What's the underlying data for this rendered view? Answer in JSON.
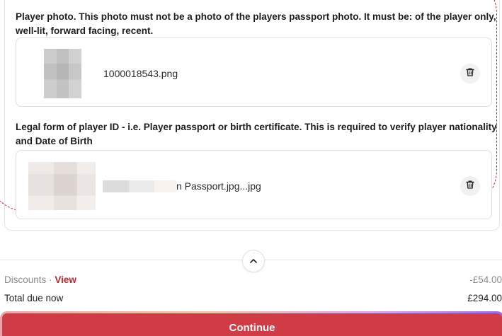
{
  "uploads": {
    "photo": {
      "label": "Player photo. This photo must not be a photo of the players passport photo. It must be: of the player only, well-lit, forward facing, recent.",
      "file_name": "1000018543.png"
    },
    "id_document": {
      "label": "Legal form of player ID - i.e. Player passport or birth certificate. This is required to verify player nationality and Date of Birth",
      "file_name": "n Passport.jpg...jpg"
    }
  },
  "summary": {
    "discounts_label": "Discounts",
    "separator": "·",
    "view_label": "View",
    "discount_amount": "-£54.00",
    "total_label": "Total due now",
    "total_amount": "£294.00"
  },
  "actions": {
    "continue_label": "Continue"
  },
  "colors": {
    "accent": "#d03c45",
    "link": "#b7272f",
    "highlight_outline": "#c0282f"
  },
  "icons": {
    "delete": "trash-icon",
    "collapse": "chevron-up-icon"
  }
}
